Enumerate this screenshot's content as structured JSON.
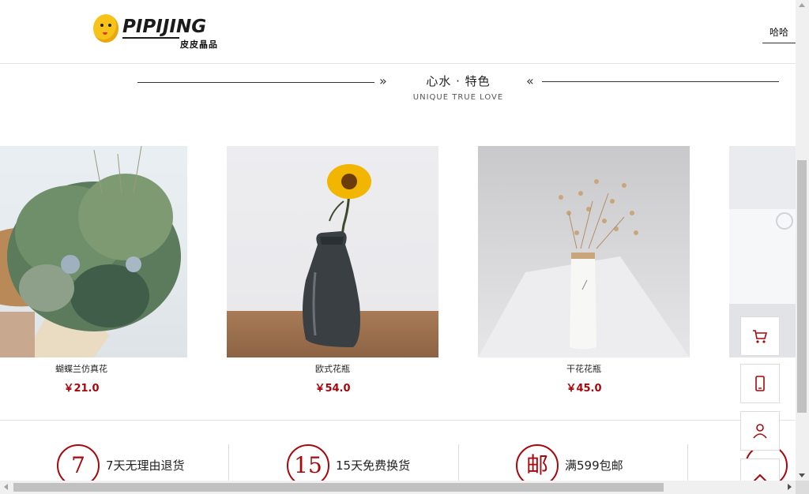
{
  "header": {
    "logo_text": "PIPIJING",
    "logo_sub": "皮皮晶品",
    "nav_link": "哈哈"
  },
  "section": {
    "title": "心水 · 特色",
    "subtitle": "UNIQUE TRUE LOVE",
    "left_chevron": "»",
    "right_chevron": "«"
  },
  "products": [
    {
      "name": "蝴蝶兰仿真花",
      "price": "￥21.0"
    },
    {
      "name": "欧式花瓶",
      "price": "￥54.0"
    },
    {
      "name": "干花花瓶",
      "price": "￥45.0"
    }
  ],
  "services": [
    {
      "badge": "7",
      "text": "7天无理由退货"
    },
    {
      "badge": "15",
      "text": "15天免费换货"
    },
    {
      "badge": "邮",
      "text": "满599包邮"
    },
    {
      "badge": "",
      "text": ""
    }
  ],
  "sidebar": {
    "icons": [
      "cart-icon",
      "phone-icon",
      "user-icon",
      "chevron-up-icon"
    ]
  },
  "colors": {
    "accent": "#a8070c",
    "border": "#dddddd"
  }
}
